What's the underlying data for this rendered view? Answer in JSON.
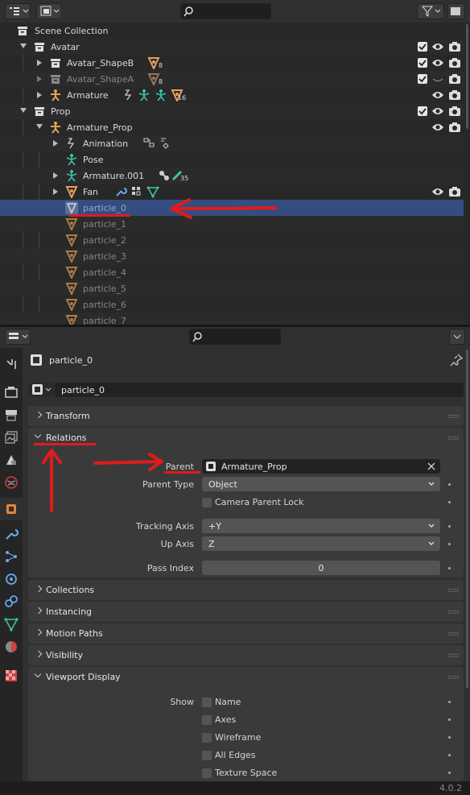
{
  "outliner": {
    "search_placeholder": "",
    "rows": [
      {
        "label": "Scene Collection"
      },
      {
        "label": "Avatar"
      },
      {
        "label": "Avatar_ShapeB",
        "count": "8"
      },
      {
        "label": "Avatar_ShapeA",
        "count": "8"
      },
      {
        "label": "Armature",
        "count": "16"
      },
      {
        "label": "Prop"
      },
      {
        "label": "Armature_Prop"
      },
      {
        "label": "Animation"
      },
      {
        "label": "Pose"
      },
      {
        "label": "Armature.001",
        "count": "35"
      },
      {
        "label": "Fan"
      },
      {
        "label": "particle_0"
      },
      {
        "label": "particle_1"
      },
      {
        "label": "particle_2"
      },
      {
        "label": "particle_3"
      },
      {
        "label": "particle_4"
      },
      {
        "label": "particle_5"
      },
      {
        "label": "particle_6"
      },
      {
        "label": "particle_7"
      }
    ]
  },
  "properties": {
    "search_placeholder": "",
    "context_name": "particle_0",
    "object_name": "particle_0",
    "panels": {
      "transform": "Transform",
      "relations": "Relations",
      "collections": "Collections",
      "instancing": "Instancing",
      "motion_paths": "Motion Paths",
      "visibility": "Visibility",
      "viewport_display": "Viewport Display"
    },
    "relations": {
      "parent_label": "Parent",
      "parent_value": "Armature_Prop",
      "parent_type_label": "Parent Type",
      "parent_type_value": "Object",
      "camera_parent_lock": "Camera Parent Lock",
      "tracking_axis_label": "Tracking Axis",
      "tracking_axis_value": "+Y",
      "up_axis_label": "Up Axis",
      "up_axis_value": "Z",
      "pass_index_label": "Pass Index",
      "pass_index_value": "0"
    },
    "viewport_display": {
      "show_label": "Show",
      "options": [
        "Name",
        "Axes",
        "Wireframe",
        "All Edges",
        "Texture Space"
      ]
    }
  },
  "version": "4.0.2",
  "colors": {
    "selection": "#334d80",
    "annotation": "#e01b1b",
    "object_orange": "#e8a05a",
    "armature_green": "#3fc4a8"
  }
}
